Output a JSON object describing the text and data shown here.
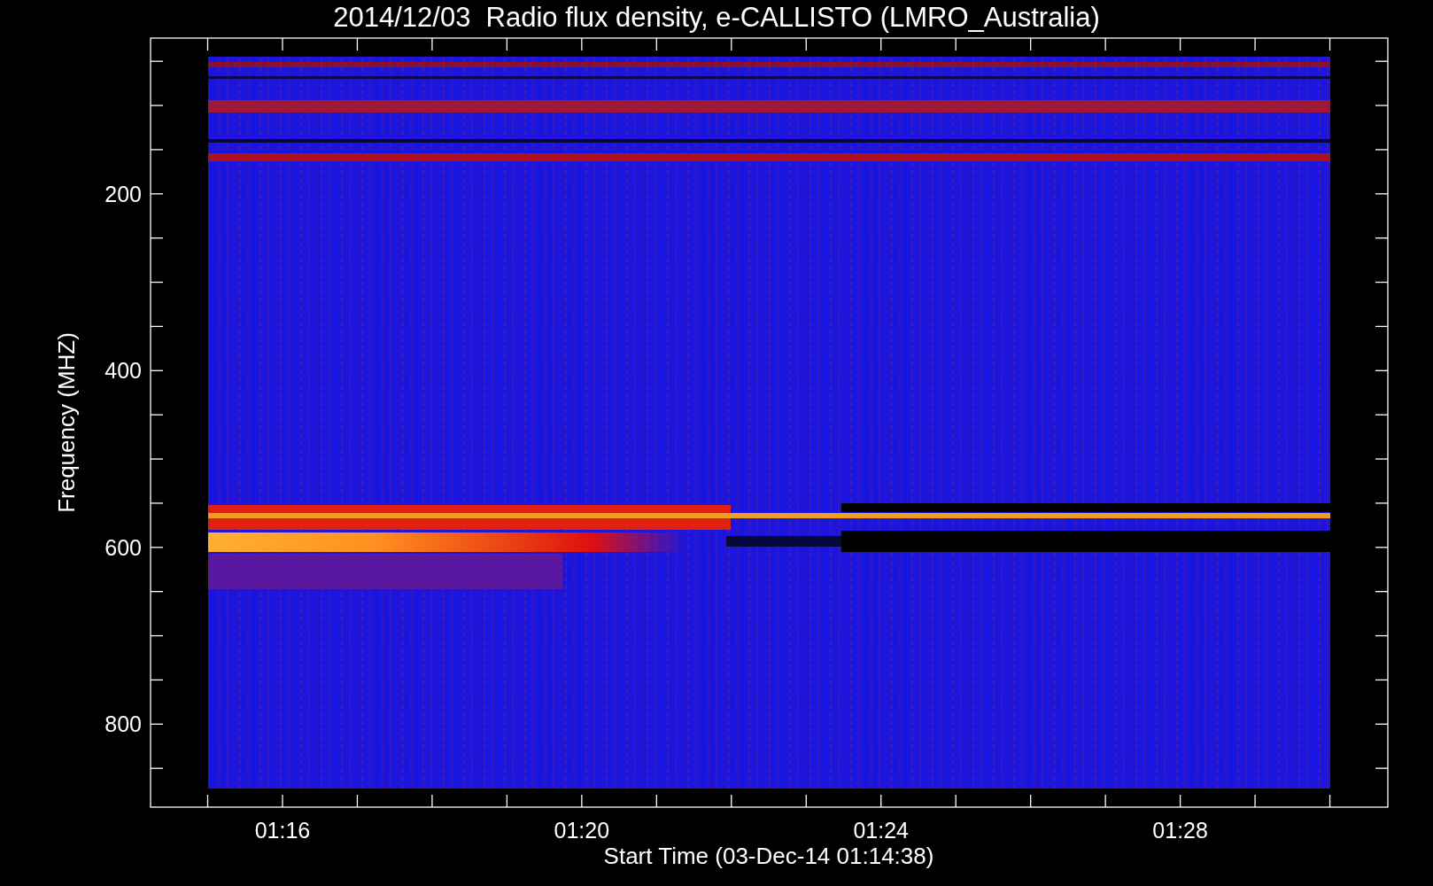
{
  "title": "2014/12/03  Radio flux density, e-CALLISTO (LMRO_Australia)",
  "y_axis": {
    "label": "Frequency (MHZ)",
    "tick_labels": [
      "200",
      "400",
      "600",
      "800"
    ]
  },
  "x_axis": {
    "label": "Start Time (03-Dec-14 01:14:38)",
    "tick_labels": [
      "01:16",
      "01:20",
      "01:24",
      "01:28"
    ]
  }
}
